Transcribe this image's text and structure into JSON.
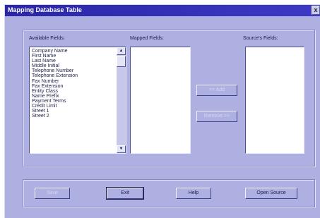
{
  "window": {
    "title": "Mapping Database Table",
    "close_glyph": "x"
  },
  "available_fields": {
    "label": "Available Fields:",
    "items": [
      "Company Name",
      "First Name",
      "Last Name",
      "Middle Initial",
      "Telephone Number",
      "Telephone Extension",
      "Fax Number",
      "Fax Extension",
      "Entity Class",
      "Name Prefix",
      "Payment Terms",
      "Credit Limit",
      "Street 1",
      "Street 2"
    ],
    "scroll_up": "▲",
    "scroll_down": "▼"
  },
  "mapped_fields": {
    "label": "Mapped Fields:",
    "items": []
  },
  "source_fields": {
    "label": "Source's Fields:",
    "items": []
  },
  "actions": {
    "add_label": "<< Add",
    "remove_label": "Remove >>"
  },
  "footer": {
    "save_label": "Save",
    "exit_label": "Exit",
    "help_label": "Help",
    "open_source_label": "Open Source"
  },
  "colors": {
    "title_bar": "#2a26a6",
    "window_bg": "#aeb0e2",
    "list_bg": "#ffffff"
  }
}
